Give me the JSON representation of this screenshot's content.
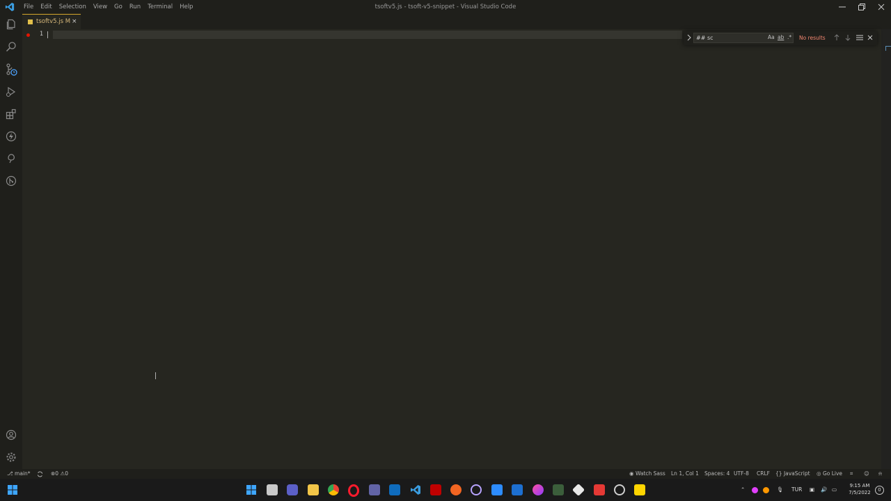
{
  "window": {
    "title": "tsoftv5.js - tsoft-v5-snippet - Visual Studio Code",
    "menu": [
      "File",
      "Edit",
      "Selection",
      "View",
      "Go",
      "Run",
      "Terminal",
      "Help"
    ]
  },
  "activity_bar": {
    "top": [
      "explorer-icon",
      "search-icon",
      "source-control-icon",
      "run-debug-icon",
      "extensions-icon",
      "lightning-icon",
      "tree-icon",
      "git-graph-icon"
    ],
    "bottom": [
      "accounts-icon",
      "settings-gear-icon"
    ]
  },
  "tab": {
    "filename": "tsoftv5.js",
    "status": "M",
    "close": "×"
  },
  "editor": {
    "line_number": "1"
  },
  "find_widget": {
    "query": "## sc",
    "match_case": "Aa",
    "whole_word": "ab",
    "regex": ".*",
    "result": "No results"
  },
  "status_bar": {
    "branch": "main*",
    "errors": "0",
    "warnings": "0",
    "watch_sass": "Watch Sass",
    "position": "Ln 1, Col 1",
    "spaces": "Spaces: 4",
    "encoding": "UTF-8",
    "eol": "CRLF",
    "language": "JavaScript",
    "go_live": "Go Live"
  },
  "taskbar": {
    "language": "TUR",
    "time": "9:15 AM",
    "date": "7/5/2022",
    "notification_count": "0"
  },
  "colors": {
    "editor_bg": "#262620",
    "chrome_bg": "#1f1f1b",
    "accent": "#0098ff",
    "breakpoint": "#e51400",
    "no_results": "#f48771"
  }
}
